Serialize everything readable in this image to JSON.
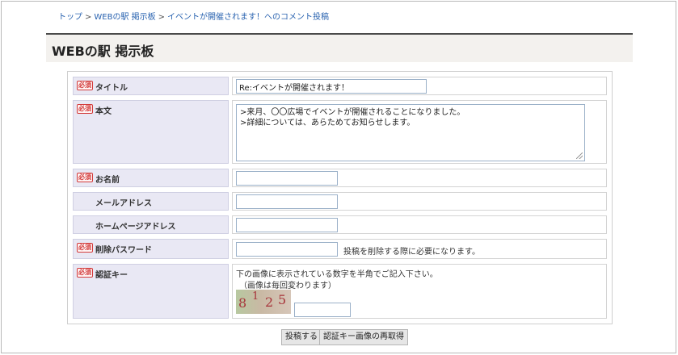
{
  "breadcrumb": {
    "items": [
      "トップ",
      "WEBの駅 掲示板",
      "イベントが開催されます！へのコメント投稿"
    ],
    "separator": ">"
  },
  "page": {
    "title": "WEBの駅 掲示板"
  },
  "required_badge": "必須",
  "form": {
    "title": {
      "label": "タイトル",
      "required": true,
      "value": "Re:イベントが開催されます！"
    },
    "body": {
      "label": "本文",
      "required": true,
      "lines": [
        ">来月、〇〇広場でイベントが開催されることになりました。",
        ">詳細については、あらためてお知らせします。"
      ]
    },
    "name": {
      "label": "お名前",
      "required": true,
      "value": ""
    },
    "email": {
      "label": "メールアドレス",
      "required": false,
      "value": ""
    },
    "homepage": {
      "label": "ホームページアドレス",
      "required": false,
      "value": ""
    },
    "delete_password": {
      "label": "削除パスワード",
      "required": true,
      "value": "",
      "note": "投稿を削除する際に必要になります。"
    },
    "auth_key": {
      "label": "認証キー",
      "required": true,
      "instruction": "下の画像に表示されている数字を半角でご記入下さい。",
      "sub_instruction": "（画像は毎回変わります）",
      "captcha_digits": [
        "8",
        "1",
        "2",
        "5"
      ],
      "value": ""
    }
  },
  "buttons": {
    "submit": "投稿する",
    "reload_captcha": "認証キー画像の再取得"
  },
  "colors": {
    "link": "#2a63b0",
    "badge": "#d23a3a",
    "label_bg": "#e9e8f4",
    "title_bar_bg": "#f3f1ee"
  }
}
